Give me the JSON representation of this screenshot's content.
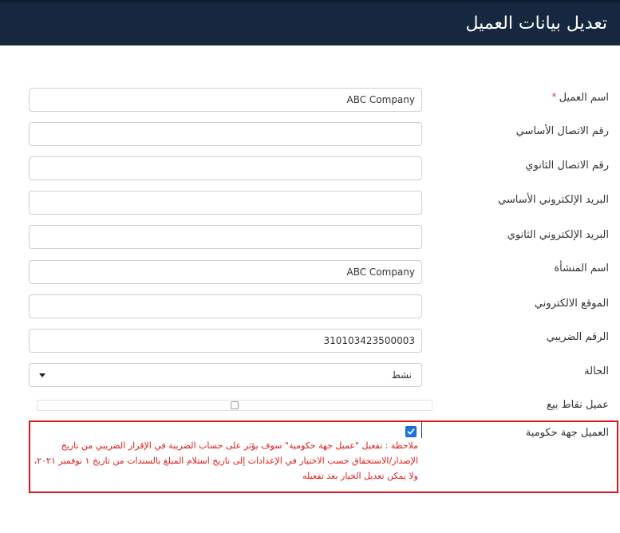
{
  "header": {
    "title": "تعديل بيانات العميل"
  },
  "form": {
    "customer_name": {
      "label": "اسم العميل",
      "required_mark": "*",
      "value": "ABC Company"
    },
    "primary_phone": {
      "label": "رقم الاتصال الأساسي",
      "value": ""
    },
    "secondary_phone": {
      "label": "رقم الاتصال الثانوي",
      "value": ""
    },
    "primary_email": {
      "label": "البريد الإلكتروني الأساسي",
      "value": ""
    },
    "secondary_email": {
      "label": "البريد الإلكتروني الثانوي",
      "value": ""
    },
    "company_name": {
      "label": "اسم المنشأة",
      "value": "ABC Company"
    },
    "website": {
      "label": "الموقع الالكتروني",
      "value": ""
    },
    "tax_number": {
      "label": "الرقم الضريبي",
      "value": "310103423500003"
    },
    "status": {
      "label": "الحالة",
      "value": "نشط"
    },
    "pos_customer": {
      "label": "عميل نقاط بيع",
      "checked": false
    },
    "government_customer": {
      "label": "العميل جهة حكومية",
      "checked": true,
      "note_lines": [
        "ملاحظة : تفعيل \"عميل جهة حكومية\" سوف يؤثر على حساب الضريبة في الإقرار الضريبي من تاريخ",
        "الإصدار/الاستحقاق حسب الاختيار في الإعدادات إلى تاريخ استلام المبلغ بالسندات من تاريخ ١ نوفمبر ٢٠٢١،",
        "ولا يمكن تعديل الخيار بعد تفعيله"
      ]
    }
  },
  "colors": {
    "header_bg": "#15283f",
    "note_text": "#e01b1b",
    "highlight_border": "#dd1515",
    "check_blue": "#1a73e8"
  }
}
